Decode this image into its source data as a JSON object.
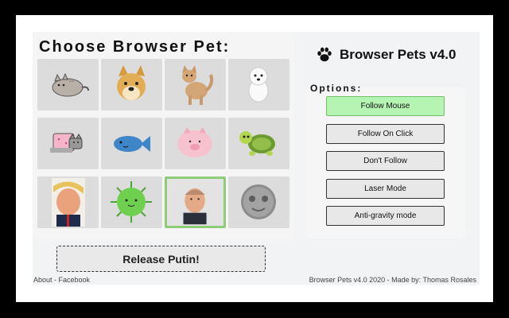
{
  "pets": {
    "title": "Choose Browser Pet:",
    "tiles": [
      {
        "name": "pusheen-cat",
        "selected": false
      },
      {
        "name": "doge",
        "selected": false
      },
      {
        "name": "cat",
        "selected": false
      },
      {
        "name": "white-dog",
        "selected": false
      },
      {
        "name": "nyan-cat",
        "selected": false
      },
      {
        "name": "blue-fish",
        "selected": false
      },
      {
        "name": "pink-pig",
        "selected": false
      },
      {
        "name": "turtle",
        "selected": false
      },
      {
        "name": "trump",
        "selected": false
      },
      {
        "name": "virus",
        "selected": false
      },
      {
        "name": "putin",
        "selected": true
      },
      {
        "name": "moon-face",
        "selected": false
      }
    ],
    "release_label": "Release Putin!"
  },
  "brand": {
    "icon": "paw-icon",
    "title": "Browser Pets v4.0"
  },
  "options": {
    "label": "Options:",
    "buttons": [
      {
        "label": "Follow Mouse",
        "active": true
      },
      {
        "label": "Follow On Click",
        "active": false
      },
      {
        "label": "Don't Follow",
        "active": false
      },
      {
        "label": "Laser Mode",
        "active": false
      },
      {
        "label": "Anti-gravity mode",
        "active": false
      }
    ]
  },
  "footer": {
    "links": "About - Facebook",
    "credits": "Browser Pets v4.0 2020 - Made by: Thomas Rosales"
  },
  "colors": {
    "active_option": "#b6f4b3",
    "selected_tile_border": "#8fcc78"
  }
}
